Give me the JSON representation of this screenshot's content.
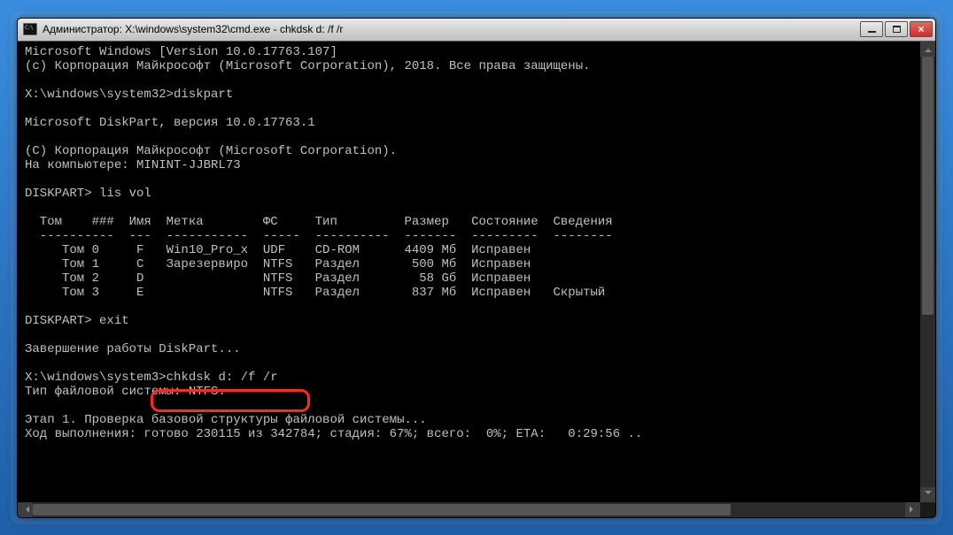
{
  "window": {
    "title": "Администратор: X:\\windows\\system32\\cmd.exe - chkdsk  d: /f /r"
  },
  "terminal": {
    "lines": {
      "l1": "Microsoft Windows [Version 10.0.17763.107]",
      "l2": "(c) Корпорация Майкрософт (Microsoft Corporation), 2018. Все права защищены.",
      "l3": "",
      "l4": "X:\\windows\\system32>diskpart",
      "l5": "",
      "l6": "Microsoft DiskPart, версия 10.0.17763.1",
      "l7": "",
      "l8": "(C) Корпорация Майкрософт (Microsoft Corporation).",
      "l9": "На компьютере: MININT-JJBRL73",
      "l10": "",
      "l11": "DISKPART> lis vol",
      "l12": "",
      "l13": "  Том    ###  Имя  Метка        ФС     Тип         Размер   Состояние  Сведения",
      "l14": "  ----------  ---  -----------  -----  ----------  -------  ---------  --------",
      "l15": "     Том 0     F   Win10_Pro_x  UDF    CD-ROM      4409 Мб  Исправен",
      "l16": "     Том 1     C   Зарезервиро  NTFS   Раздел       500 Мб  Исправен",
      "l17": "     Том 2     D                NTFS   Раздел        58 Gб  Исправен",
      "l18": "     Том 3     E                NTFS   Раздел       837 Мб  Исправен   Скрытый",
      "l19": "",
      "l20": "DISKPART> exit",
      "l21": "",
      "l22": "Завершение работы DiskPart...",
      "l23": "",
      "l24_prompt": "X:\\windows\\system3",
      "l24_cmd": ">chkdsk d: /f /r",
      "l25": "Тип файловой системы: NTFS.",
      "l26": "",
      "l27": "Этап 1. Проверка базовой структуры файловой системы...",
      "l28": "Ход выполнения: готово 230115 из 342784; стадия: 67%; всего:  0%; ETA:   0:29:56 .."
    }
  },
  "diskpart_volumes": [
    {
      "vol": "Том 0",
      "letter": "F",
      "label": "Win10_Pro_x",
      "fs": "UDF",
      "type": "CD-ROM",
      "size": "4409 Мб",
      "status": "Исправен",
      "info": ""
    },
    {
      "vol": "Том 1",
      "letter": "C",
      "label": "Зарезервиро",
      "fs": "NTFS",
      "type": "Раздел",
      "size": "500 Мб",
      "status": "Исправен",
      "info": ""
    },
    {
      "vol": "Том 2",
      "letter": "D",
      "label": "",
      "fs": "NTFS",
      "type": "Раздел",
      "size": "58 Gб",
      "status": "Исправен",
      "info": ""
    },
    {
      "vol": "Том 3",
      "letter": "E",
      "label": "",
      "fs": "NTFS",
      "type": "Раздел",
      "size": "837 Мб",
      "status": "Исправен",
      "info": "Скрытый"
    }
  ],
  "highlighted_command": "chkdsk d: /f /r",
  "chkdsk_progress": {
    "stage": 1,
    "done": 230115,
    "total": 342784,
    "stage_percent": 67,
    "overall_percent": 0,
    "eta": "0:29:56"
  }
}
